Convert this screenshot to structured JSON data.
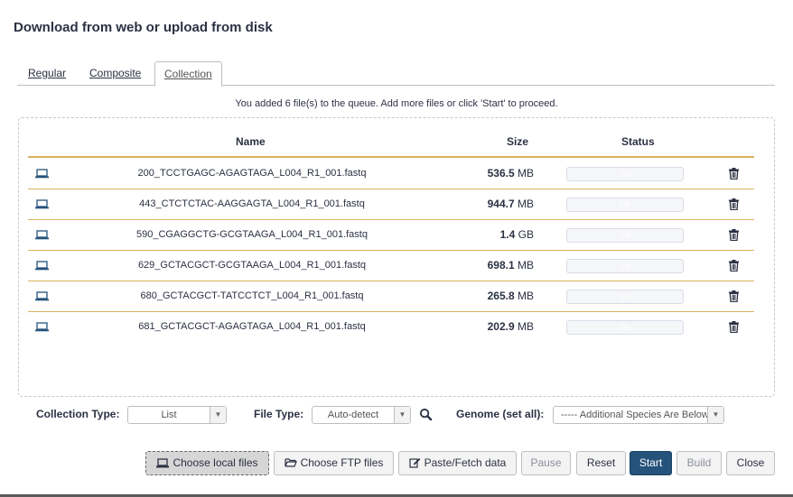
{
  "dialog": {
    "title": "Download from web or upload from disk"
  },
  "tabs": [
    {
      "label": "Regular"
    },
    {
      "label": "Composite"
    },
    {
      "label": "Collection"
    }
  ],
  "queue_message": "You added 6 file(s) to the queue. Add more files or click 'Start' to proceed.",
  "table": {
    "headers": {
      "name": "Name",
      "size": "Size",
      "status": "Status"
    },
    "rows": [
      {
        "name": "200_TCCTGAGC-AGAGTAGA_L004_R1_001.fastq",
        "size_value": "536.5",
        "size_unit": "MB",
        "progress": "0%"
      },
      {
        "name": "443_CTCTCTAC-AAGGAGTA_L004_R1_001.fastq",
        "size_value": "944.7",
        "size_unit": "MB",
        "progress": "0%"
      },
      {
        "name": "590_CGAGGCTG-GCGTAAGA_L004_R1_001.fastq",
        "size_value": "1.4",
        "size_unit": "GB",
        "progress": "0%"
      },
      {
        "name": "629_GCTACGCT-GCGTAAGA_L004_R1_001.fastq",
        "size_value": "698.1",
        "size_unit": "MB",
        "progress": "0%"
      },
      {
        "name": "680_GCTACGCT-TATCCTCT_L004_R1_001.fastq",
        "size_value": "265.8",
        "size_unit": "MB",
        "progress": "0%"
      },
      {
        "name": "681_GCTACGCT-AGAGTAGA_L004_R1_001.fastq",
        "size_value": "202.9",
        "size_unit": "MB",
        "progress": "0%"
      }
    ]
  },
  "options": {
    "collection_type": {
      "label": "Collection Type:",
      "value": "List"
    },
    "file_type": {
      "label": "File Type:",
      "value": "Auto-detect"
    },
    "genome": {
      "label": "Genome (set all):",
      "value": "----- Additional Species Are Below -----"
    }
  },
  "buttons": {
    "choose_local": "Choose local files",
    "choose_ftp": "Choose FTP files",
    "paste_fetch": "Paste/Fetch data",
    "pause": "Pause",
    "reset": "Reset",
    "start": "Start",
    "build": "Build",
    "close": "Close"
  },
  "colors": {
    "primary": "#25537b",
    "row_divider": "#d9b25f",
    "text": "#2c3143"
  }
}
